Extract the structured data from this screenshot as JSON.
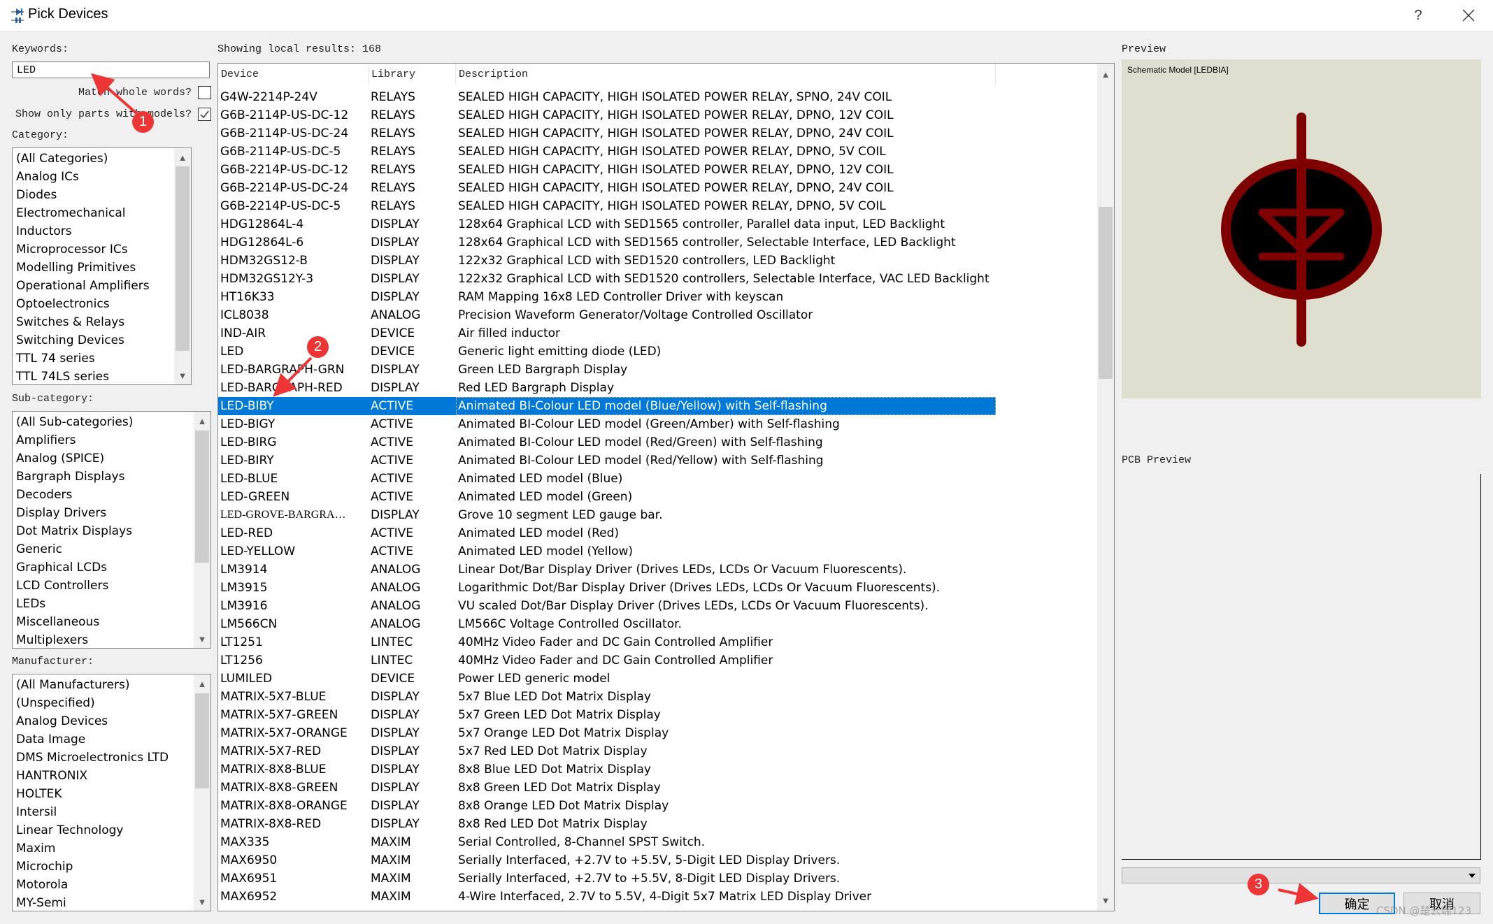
{
  "window": {
    "title": "Pick Devices",
    "help_label": "?",
    "close_label": "✕"
  },
  "keywords": {
    "label": "Keywords:",
    "value": "LED",
    "match_whole_words_label": "Match whole words?",
    "match_whole_words_checked": false,
    "show_only_models_label": "Show only parts with models?",
    "show_only_models_checked": true
  },
  "category": {
    "label": "Category:",
    "items": [
      "(All Categories)",
      "Analog ICs",
      "Diodes",
      "Electromechanical",
      "Inductors",
      "Microprocessor ICs",
      "Modelling Primitives",
      "Operational Amplifiers",
      "Optoelectronics",
      "Switches & Relays",
      "Switching Devices",
      "TTL 74 series",
      "TTL 74LS series"
    ]
  },
  "subcategory": {
    "label": "Sub-category:",
    "items": [
      "(All Sub-categories)",
      "Amplifiers",
      "Analog (SPICE)",
      "Bargraph Displays",
      "Decoders",
      "Display Drivers",
      "Dot Matrix Displays",
      "Generic",
      "Graphical LCDs",
      "LCD Controllers",
      "LEDs",
      "Miscellaneous",
      "Multiplexers"
    ]
  },
  "manufacturer": {
    "label": "Manufacturer:",
    "items": [
      "(All Manufacturers)",
      "(Unspecified)",
      "Analog Devices",
      "Data Image",
      "DMS Microelectronics LTD",
      "HANTRONIX",
      "HOLTEK",
      "Intersil",
      "Linear Technology",
      "Maxim",
      "Microchip",
      "Motorola",
      "MY-Semi"
    ]
  },
  "results": {
    "summary": "Showing local results: 168",
    "columns": [
      "Device",
      "Library",
      "Description"
    ],
    "selected_device": "LED-BIBY",
    "rows": [
      {
        "device": "G4W-2214P-24V",
        "library": "RELAYS",
        "description": "SEALED HIGH CAPACITY, HIGH ISOLATED POWER RELAY, SPNO, 24V COIL"
      },
      {
        "device": "G6B-2114P-US-DC-12",
        "library": "RELAYS",
        "description": "SEALED HIGH CAPACITY, HIGH ISOLATED POWER RELAY, DPNO, 12V COIL"
      },
      {
        "device": "G6B-2114P-US-DC-24",
        "library": "RELAYS",
        "description": "SEALED HIGH CAPACITY, HIGH ISOLATED POWER RELAY, DPNO, 24V COIL"
      },
      {
        "device": "G6B-2114P-US-DC-5",
        "library": "RELAYS",
        "description": "SEALED HIGH CAPACITY, HIGH ISOLATED POWER RELAY, DPNO, 5V COIL"
      },
      {
        "device": "G6B-2214P-US-DC-12",
        "library": "RELAYS",
        "description": "SEALED HIGH CAPACITY, HIGH ISOLATED POWER RELAY, DPNO, 12V COIL"
      },
      {
        "device": "G6B-2214P-US-DC-24",
        "library": "RELAYS",
        "description": "SEALED HIGH CAPACITY, HIGH ISOLATED POWER RELAY, DPNO, 24V COIL"
      },
      {
        "device": "G6B-2214P-US-DC-5",
        "library": "RELAYS",
        "description": "SEALED HIGH CAPACITY, HIGH ISOLATED POWER RELAY, DPNO, 5V COIL"
      },
      {
        "device": "HDG12864L-4",
        "library": "DISPLAY",
        "description": "128x64 Graphical LCD with SED1565 controller, Parallel data input, LED Backlight"
      },
      {
        "device": "HDG12864L-6",
        "library": "DISPLAY",
        "description": "128x64 Graphical LCD with SED1565 controller, Selectable Interface, LED Backlight"
      },
      {
        "device": "HDM32GS12-B",
        "library": "DISPLAY",
        "description": "122x32 Graphical LCD with SED1520 controllers, LED Backlight"
      },
      {
        "device": "HDM32GS12Y-3",
        "library": "DISPLAY",
        "description": "122x32 Graphical LCD with SED1520 controllers, Selectable Interface, VAC LED Backlight"
      },
      {
        "device": "HT16K33",
        "library": "DISPLAY",
        "description": "RAM Mapping 16x8 LED Controller Driver with keyscan"
      },
      {
        "device": "ICL8038",
        "library": "ANALOG",
        "description": "Precision Waveform Generator/Voltage Controlled Oscillator"
      },
      {
        "device": "IND-AIR",
        "library": "DEVICE",
        "description": "Air filled inductor"
      },
      {
        "device": "LED",
        "library": "DEVICE",
        "description": "Generic light emitting diode (LED)"
      },
      {
        "device": "LED-BARGRAPH-GRN",
        "library": "DISPLAY",
        "description": "Green LED Bargraph Display"
      },
      {
        "device": "LED-BARGRAPH-RED",
        "library": "DISPLAY",
        "description": "Red LED Bargraph Display"
      },
      {
        "device": "LED-BIBY",
        "library": "ACTIVE",
        "description": "Animated BI-Colour LED model (Blue/Yellow) with Self-flashing"
      },
      {
        "device": "LED-BIGY",
        "library": "ACTIVE",
        "description": "Animated BI-Colour LED model (Green/Amber) with Self-flashing"
      },
      {
        "device": "LED-BIRG",
        "library": "ACTIVE",
        "description": "Animated BI-Colour LED model (Red/Green) with Self-flashing"
      },
      {
        "device": "LED-BIRY",
        "library": "ACTIVE",
        "description": "Animated BI-Colour LED model (Red/Yellow) with Self-flashing"
      },
      {
        "device": "LED-BLUE",
        "library": "ACTIVE",
        "description": "Animated LED model (Blue)"
      },
      {
        "device": "LED-GREEN",
        "library": "ACTIVE",
        "description": "Animated LED model (Green)"
      },
      {
        "device": "LED-GROVE-BARGRA…",
        "library": "DISPLAY",
        "description": "Grove 10 segment LED gauge bar."
      },
      {
        "device": "LED-RED",
        "library": "ACTIVE",
        "description": "Animated LED model (Red)"
      },
      {
        "device": "LED-YELLOW",
        "library": "ACTIVE",
        "description": "Animated LED model (Yellow)"
      },
      {
        "device": "LM3914",
        "library": "ANALOG",
        "description": "Linear Dot/Bar Display Driver (Drives LEDs, LCDs Or Vacuum Fluorescents)."
      },
      {
        "device": "LM3915",
        "library": "ANALOG",
        "description": "Logarithmic Dot/Bar Display Driver (Drives LEDs, LCDs Or Vacuum Fluorescents)."
      },
      {
        "device": "LM3916",
        "library": "ANALOG",
        "description": "VU scaled Dot/Bar Display Driver (Drives LEDs, LCDs Or Vacuum Fluorescents)."
      },
      {
        "device": "LM566CN",
        "library": "ANALOG",
        "description": "LM566C Voltage Controlled Oscillator."
      },
      {
        "device": "LT1251",
        "library": "LINTEC",
        "description": "40MHz Video Fader and  DC Gain Controlled Amplifier"
      },
      {
        "device": "LT1256",
        "library": "LINTEC",
        "description": "40MHz Video Fader and  DC Gain Controlled Amplifier"
      },
      {
        "device": "LUMILED",
        "library": "DEVICE",
        "description": "Power LED generic model"
      },
      {
        "device": "MATRIX-5X7-BLUE",
        "library": "DISPLAY",
        "description": "5x7 Blue LED Dot Matrix Display"
      },
      {
        "device": "MATRIX-5X7-GREEN",
        "library": "DISPLAY",
        "description": "5x7 Green LED Dot Matrix Display"
      },
      {
        "device": "MATRIX-5X7-ORANGE",
        "library": "DISPLAY",
        "description": "5x7 Orange LED Dot Matrix Display"
      },
      {
        "device": "MATRIX-5X7-RED",
        "library": "DISPLAY",
        "description": "5x7 Red LED Dot Matrix Display"
      },
      {
        "device": "MATRIX-8X8-BLUE",
        "library": "DISPLAY",
        "description": "8x8 Blue LED Dot Matrix Display"
      },
      {
        "device": "MATRIX-8X8-GREEN",
        "library": "DISPLAY",
        "description": "8x8 Green LED Dot Matrix Display"
      },
      {
        "device": "MATRIX-8X8-ORANGE",
        "library": "DISPLAY",
        "description": "8x8 Orange LED Dot Matrix Display"
      },
      {
        "device": "MATRIX-8X8-RED",
        "library": "DISPLAY",
        "description": "8x8 Red LED Dot Matrix Display"
      },
      {
        "device": "MAX335",
        "library": "MAXIM",
        "description": "Serial Controlled, 8-Channel SPST Switch."
      },
      {
        "device": "MAX6950",
        "library": "MAXIM",
        "description": "Serially Interfaced, +2.7V to +5.5V, 5-Digit LED Display Drivers."
      },
      {
        "device": "MAX6951",
        "library": "MAXIM",
        "description": "Serially Interfaced, +2.7V to +5.5V, 8-Digit LED Display Drivers."
      },
      {
        "device": "MAX6952",
        "library": "MAXIM",
        "description": "4-Wire Interfaced, 2.7V to 5.5V, 4-Digit 5x7 Matrix LED Display Driver"
      }
    ]
  },
  "preview": {
    "label": "Preview",
    "schematic_caption": "Schematic Model [LEDBIA]",
    "pcb_label": "PCB Preview",
    "package_select_value": ""
  },
  "buttons": {
    "ok_label": "确定",
    "cancel_label": "取消"
  },
  "annotations": {
    "badge1": "1",
    "badge2": "2",
    "badge3": "3",
    "watermark": "CSDN @楚云端123"
  },
  "colors": {
    "selection": "#0078d7",
    "symbol": "#7f0000",
    "preview_bg": "#dfdfd0",
    "badge": "#ee3535"
  }
}
